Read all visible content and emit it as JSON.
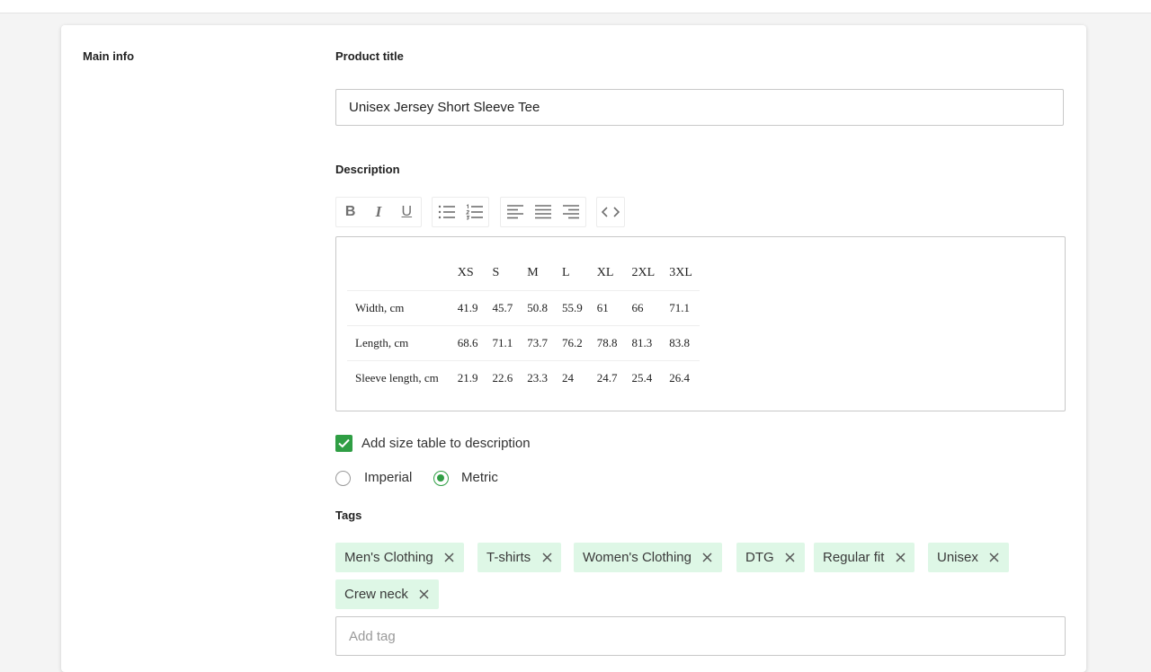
{
  "main_info": {
    "label": "Main info"
  },
  "product_title": {
    "label": "Product title",
    "value": "Unisex Jersey Short Sleeve Tee"
  },
  "description": {
    "label": "Description",
    "toolbar": {
      "bold": "B",
      "italic": "I",
      "underline": "U",
      "icons": [
        "bold-icon",
        "italic-icon",
        "underline-icon",
        "bulleted-list-icon",
        "numbered-list-icon",
        "align-left-icon",
        "align-center-icon",
        "align-right-icon",
        "code-view-icon"
      ]
    },
    "size_table": {
      "columns": [
        "",
        "XS",
        "S",
        "M",
        "L",
        "XL",
        "2XL",
        "3XL"
      ],
      "rows": [
        {
          "label": "Width, cm",
          "values": [
            "41.9",
            "45.7",
            "50.8",
            "55.9",
            "61",
            "66",
            "71.1"
          ]
        },
        {
          "label": "Length, cm",
          "values": [
            "68.6",
            "71.1",
            "73.7",
            "76.2",
            "78.8",
            "81.3",
            "83.8"
          ]
        },
        {
          "label": "Sleeve length, cm",
          "values": [
            "21.9",
            "22.6",
            "23.3",
            "24",
            "24.7",
            "25.4",
            "26.4"
          ]
        }
      ]
    }
  },
  "add_size_table": {
    "label": "Add size table to description",
    "checked": true
  },
  "units": {
    "options": [
      {
        "label": "Imperial",
        "selected": false
      },
      {
        "label": "Metric",
        "selected": true
      }
    ]
  },
  "tags": {
    "label": "Tags",
    "items": [
      "Men's Clothing",
      "T-shirts",
      "Women's Clothing",
      "DTG",
      "Regular fit",
      "Unisex",
      "Crew neck"
    ],
    "placeholder": "Add tag"
  },
  "colors": {
    "accent": "#2f9e44",
    "tag_bg": "#def7e6",
    "border": "#c8c8c8"
  }
}
